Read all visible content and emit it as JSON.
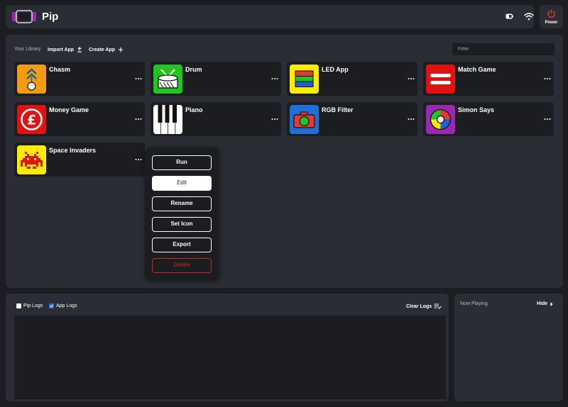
{
  "header": {
    "title": "Pip",
    "power_label": "Power"
  },
  "library": {
    "label": "Your Library",
    "import_label": "Import App",
    "create_label": "Create App",
    "filter_placeholder": "Filter"
  },
  "apps": [
    {
      "name": "Chasm",
      "icon": "chasm-icon"
    },
    {
      "name": "Drum",
      "icon": "drum-icon"
    },
    {
      "name": "LED App",
      "icon": "led-icon"
    },
    {
      "name": "Match Game",
      "icon": "match-icon"
    },
    {
      "name": "Money Game",
      "icon": "pound-icon"
    },
    {
      "name": "Piano",
      "icon": "piano-icon"
    },
    {
      "name": "RGB Filter",
      "icon": "camera-icon"
    },
    {
      "name": "Simon Says",
      "icon": "simon-icon"
    },
    {
      "name": "Space Invaders",
      "icon": "invader-icon"
    }
  ],
  "context_menu": {
    "items": [
      "Run",
      "Edit",
      "Rename",
      "Set Icon",
      "Export",
      "Delete"
    ],
    "highlighted": "Edit"
  },
  "logs": {
    "pip_logs_label": "Pip Logs",
    "pip_logs_checked": false,
    "app_logs_label": "App Logs",
    "app_logs_checked": true,
    "clear_label": "Clear Logs"
  },
  "now_playing": {
    "label": "Now Playing",
    "hide_label": "Hide"
  },
  "colors": {
    "background": "#1b1d21",
    "panel": "#2a2d33",
    "accent_blue": "#2e6fd1",
    "power_red": "#e53935",
    "delete_red": "#c62828"
  }
}
